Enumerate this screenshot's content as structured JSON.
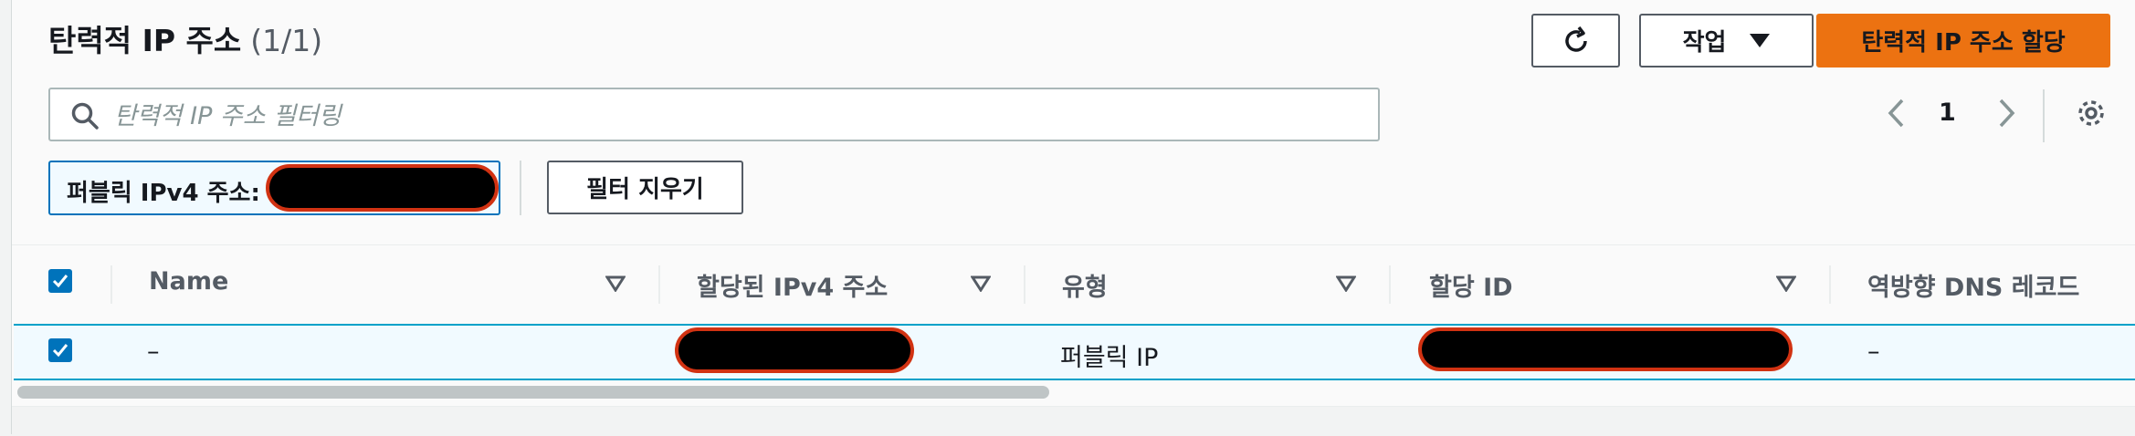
{
  "header": {
    "title": "탄력적 IP 주소",
    "count": "(1/1)",
    "actions_label": "작업",
    "allocate_label": "탄력적 IP 주소 할당"
  },
  "search": {
    "placeholder": "탄력적 IP 주소 필터링",
    "value": ""
  },
  "pagination": {
    "current_page": "1"
  },
  "filter": {
    "token_label": "퍼블릭 IPv4 주소:",
    "clear_label": "필터 지우기"
  },
  "table": {
    "columns": [
      "Name",
      "할당된 IPv4 주소",
      "유형",
      "할당 ID",
      "역방향 DNS 레코드"
    ],
    "rows": [
      {
        "name": "–",
        "type": "퍼블릭 IP",
        "reverse_dns": "–",
        "selected": true
      }
    ]
  },
  "colors": {
    "primary_button": "#ec7211",
    "selection": "#0073bb",
    "redaction_border": "#d13212"
  }
}
